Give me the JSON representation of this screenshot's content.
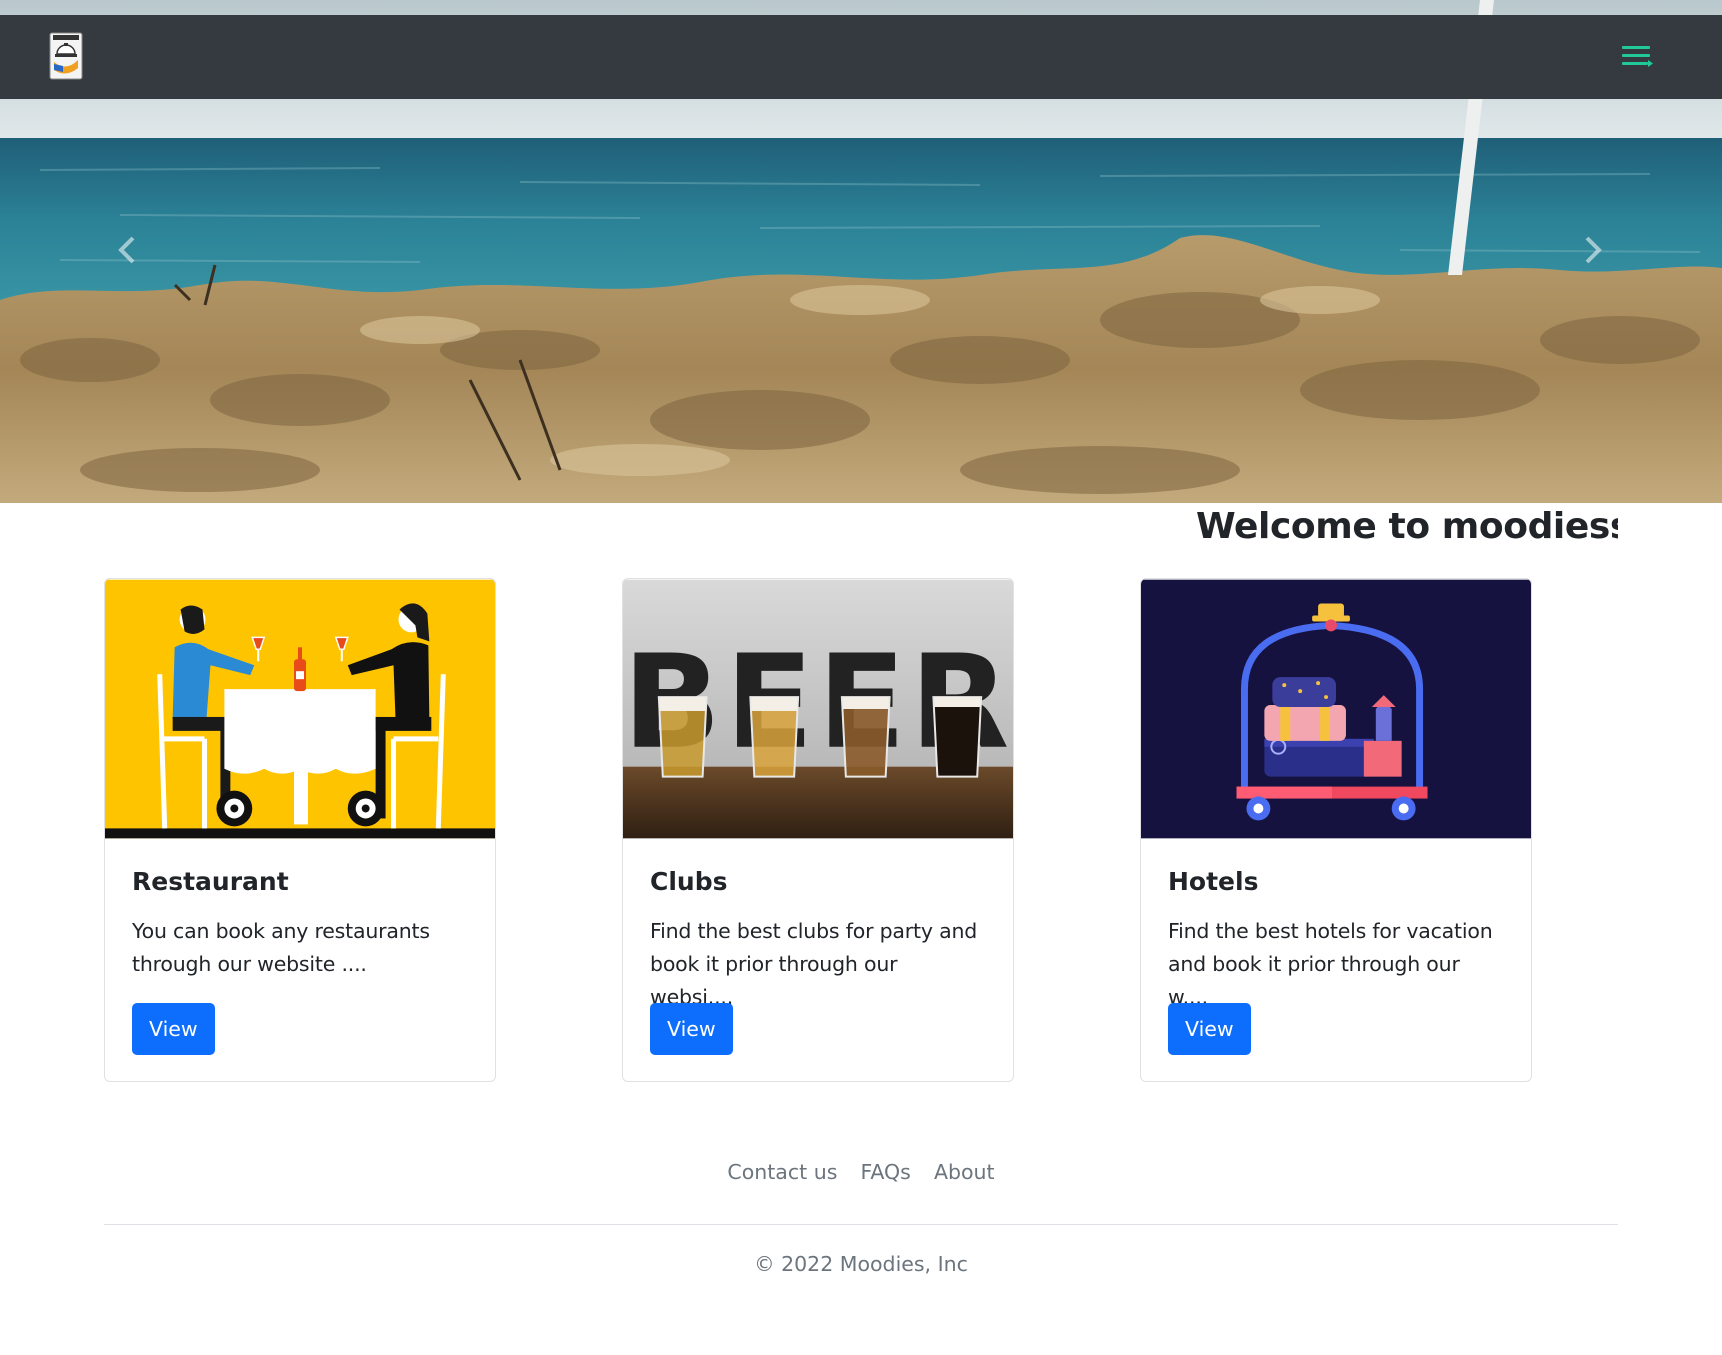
{
  "navbar": {
    "logo_icon": "restaurant-logo-icon",
    "menu_icon": "hamburger-menu-icon",
    "menu_icon_color": "#20c997",
    "background": "#343a40"
  },
  "hero": {
    "image": "beach-sand-sea-photo",
    "prev_icon": "chevron-left-icon",
    "next_icon": "chevron-right-icon"
  },
  "welcome": {
    "text": "Welcome to moodiess w"
  },
  "cards": [
    {
      "title": "Restaurant",
      "text_line1": "You can book any restaurants",
      "text_line2": "through our website ....",
      "button": "View",
      "image": "couple-dining-illustration"
    },
    {
      "title": "Clubs",
      "text_line1": "Find the best clubs for party and",
      "text_line2": "book it prior through our websi....",
      "button": "View",
      "image": "beer-glasses-photo"
    },
    {
      "title": "Hotels",
      "text_line1": "Find the best hotels for vacation",
      "text_line2": "and book it prior through our w....",
      "button": "View",
      "image": "luggage-cart-illustration"
    }
  ],
  "footer": {
    "links": [
      "Contact us",
      "FAQs",
      "About"
    ],
    "copyright": "© 2022 Moodies, Inc"
  },
  "colors": {
    "primary_button": "#0d6efd",
    "muted_text": "#6c757d"
  }
}
